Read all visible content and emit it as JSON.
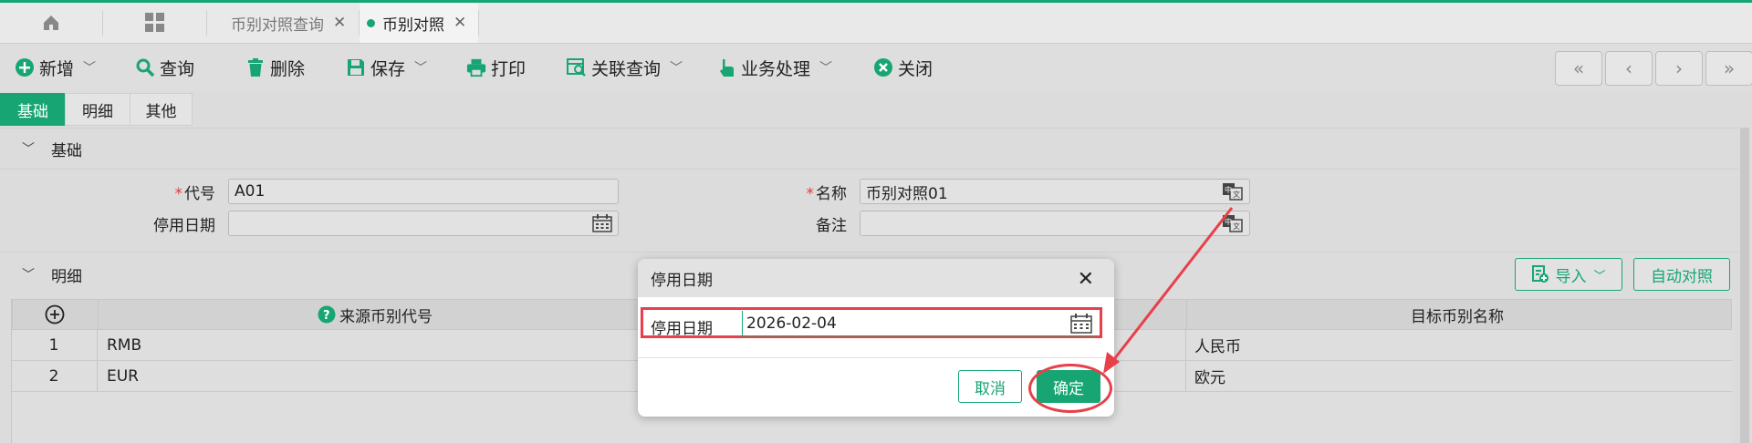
{
  "tabs": {
    "home_icon": "home-icon",
    "grid_icon": "grid-icon",
    "items": [
      {
        "label": "币别对照查询",
        "active": false
      },
      {
        "label": "币别对照",
        "active": true
      }
    ],
    "close_glyph": "✕"
  },
  "toolbar": {
    "items": [
      {
        "label": "新增",
        "icon": "plus-circle-icon",
        "has_dropdown": true
      },
      {
        "label": "查询",
        "icon": "search-icon",
        "has_dropdown": false
      },
      {
        "label": "删除",
        "icon": "trash-icon",
        "has_dropdown": false
      },
      {
        "label": "保存",
        "icon": "save-icon",
        "has_dropdown": true
      },
      {
        "label": "打印",
        "icon": "printer-icon",
        "has_dropdown": false
      },
      {
        "label": "关联查询",
        "icon": "related-search-icon",
        "has_dropdown": true
      },
      {
        "label": "业务处理",
        "icon": "hand-icon",
        "has_dropdown": true
      },
      {
        "label": "关闭",
        "icon": "close-circle-icon",
        "has_dropdown": false
      }
    ],
    "nav": [
      "«",
      "‹",
      "›",
      "»"
    ]
  },
  "subtabs": [
    {
      "label": "基础",
      "active": true
    },
    {
      "label": "明细",
      "active": false
    },
    {
      "label": "其他",
      "active": false
    }
  ],
  "basic_section": {
    "title": "基础",
    "fields": {
      "code": {
        "label": "代号",
        "required": true,
        "value": "A01"
      },
      "name": {
        "label": "名称",
        "required": true,
        "value": "币别对照01"
      },
      "stop_date": {
        "label": "停用日期",
        "required": false,
        "value": ""
      },
      "remark": {
        "label": "备注",
        "required": false,
        "value": ""
      }
    },
    "required_mark": "*"
  },
  "detail_section": {
    "title": "明细",
    "import_button": "导入",
    "auto_match_button": "自动对照",
    "columns": {
      "add_icon": "add-circle-icon",
      "source_code": "来源币别代号",
      "target_name": "目标币别名称",
      "help_icon": "help-icon"
    },
    "rows": [
      {
        "index": "1",
        "source_code": "RMB",
        "target_name": "人民币"
      },
      {
        "index": "2",
        "source_code": "EUR",
        "target_name": "欧元"
      }
    ]
  },
  "dialog": {
    "title": "停用日期",
    "field_label": "停用日期",
    "field_value": "2026-02-04",
    "cancel_label": "取消",
    "ok_label": "确定"
  },
  "colors": {
    "accent": "#17a673",
    "annotation": "#e8404b",
    "required": "#e53935"
  }
}
